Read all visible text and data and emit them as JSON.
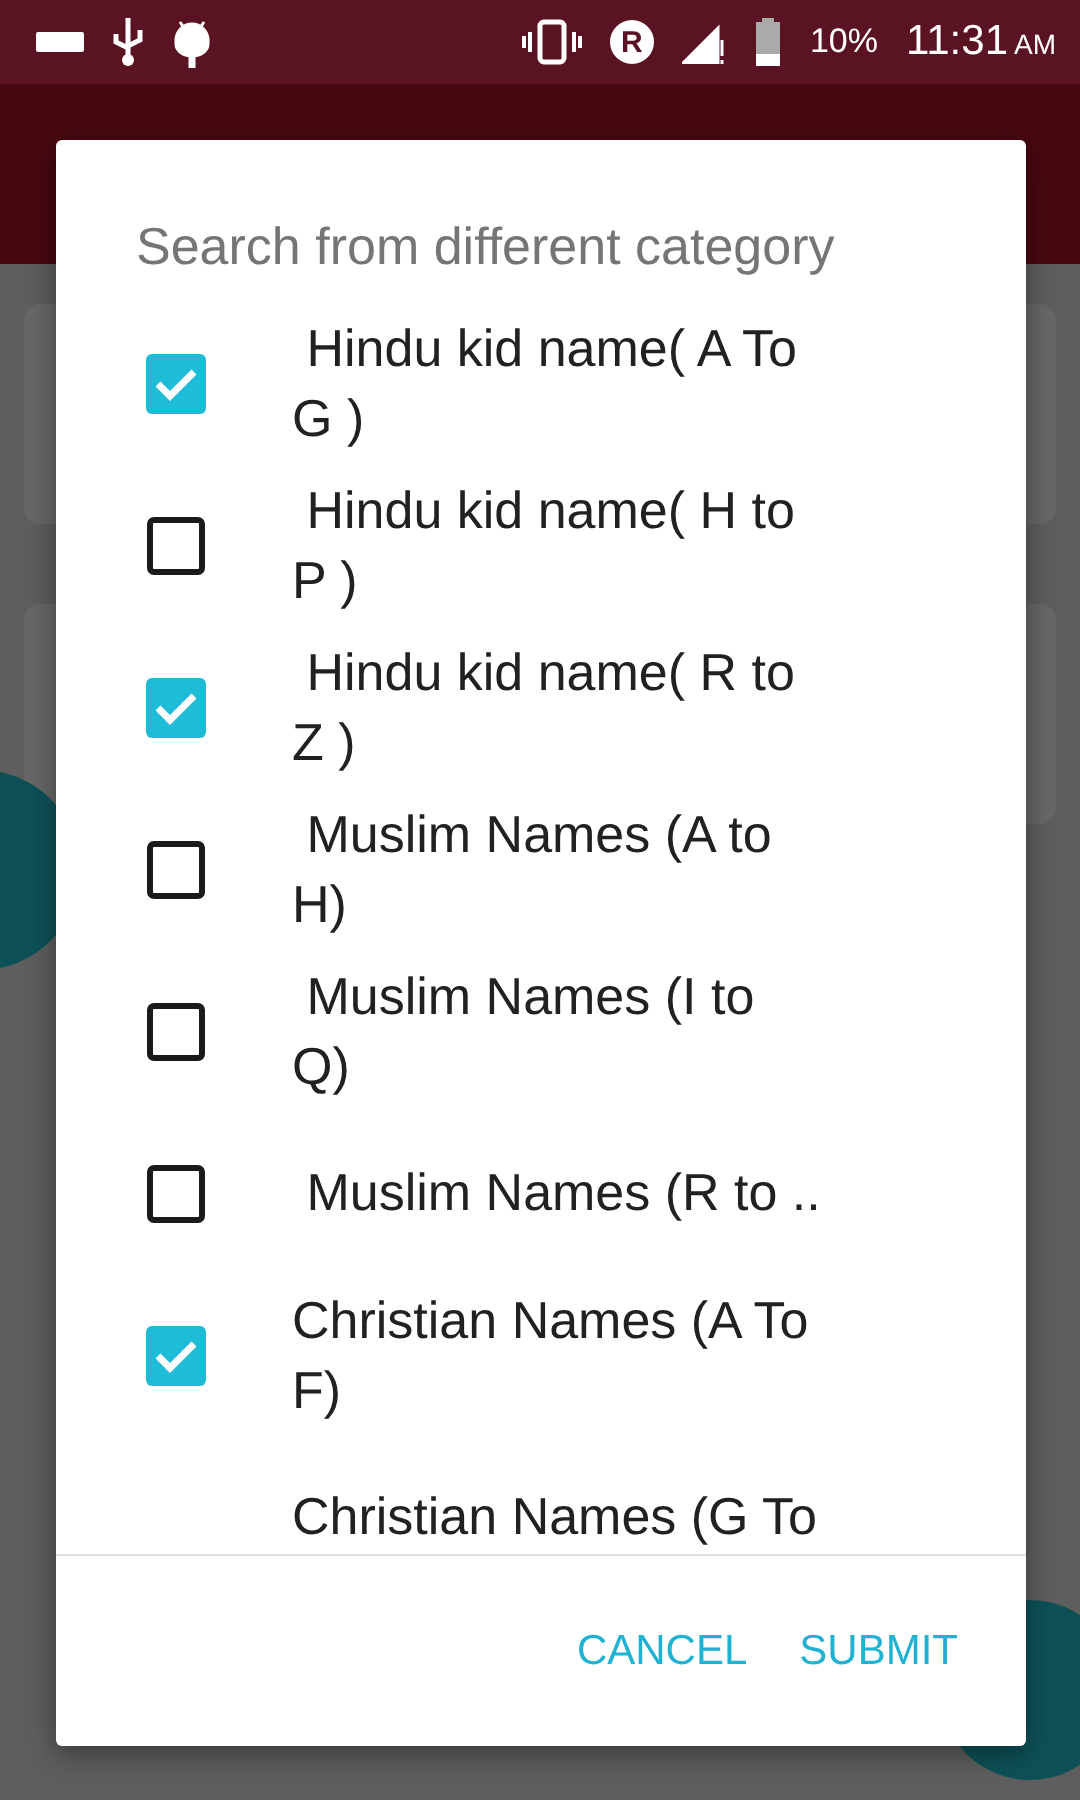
{
  "status_bar": {
    "battery": "10%",
    "time": "11:31",
    "meridiem": "AM",
    "roaming": "R"
  },
  "dialog": {
    "title": "Search from different category",
    "items": [
      {
        "label": " Hindu kid name( A To G )",
        "checked": true
      },
      {
        "label": " Hindu kid name( H to P )",
        "checked": false
      },
      {
        "label": " Hindu kid name( R to Z )",
        "checked": true
      },
      {
        "label": " Muslim Names (A to H)",
        "checked": false
      },
      {
        "label": " Muslim Names (I to Q)",
        "checked": false
      },
      {
        "label": " Muslim Names (R to ..",
        "checked": false
      },
      {
        "label": "Christian Names (A To F)",
        "checked": true
      },
      {
        "label": "Christian Names (G To"
      }
    ],
    "buttons": [
      {
        "label": "CANCEL"
      },
      {
        "label": "SUBMIT"
      }
    ]
  }
}
